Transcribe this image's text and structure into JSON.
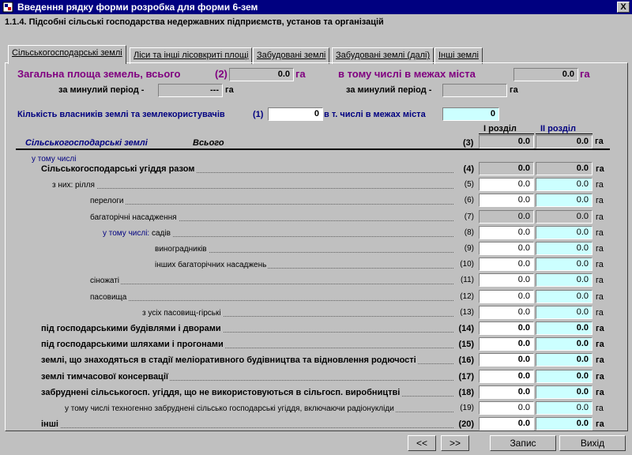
{
  "window": {
    "title": "Введення рядку форми розробка для форми 6-зем",
    "close_label": "X"
  },
  "subtitle": "1.1.4. Підсобні сільські господарства недержавних  підприємств, установ  та організацій",
  "tabs": [
    {
      "label": "Сільськогосподарські землі",
      "active": true
    },
    {
      "label": "Ліси та інші лісовкриті площі"
    },
    {
      "label": "Забудовані землі"
    },
    {
      "label": "Забудовані землі (далі)"
    },
    {
      "label": "Інші землі"
    }
  ],
  "header": {
    "total_area_label": "Загальна площа земель, всього",
    "total_area_code": "(2)",
    "total_area_value": "0.0",
    "city_label": "в тому числі в межах міста",
    "city_value": "0.0",
    "unit": "га",
    "prev_period_label": "за минулий період -",
    "prev_period_value": "---",
    "prev_period_city_label": "за минулий період -",
    "prev_period_city_value": "",
    "owners_label": "Кількість власників землі та землекористувачів",
    "owners_code": "(1)",
    "owners_value": "0",
    "owners_city_label": "в т. числі в межах міста",
    "owners_city_value": "0"
  },
  "table": {
    "section_label": "Сільськогосподарські землі",
    "total_label": "Всього",
    "total_code": "(3)",
    "col1_header": "І розділ",
    "col2_header": "ІІ розділ",
    "total_v1": "0.0",
    "total_v2": "0.0",
    "unit": "га",
    "including_note": "у тому числі",
    "rows": [
      {
        "label": "Сільськогосподарські угіддя разом",
        "code": "(4)",
        "v1": "0.0",
        "v2": "0.0",
        "bold": true,
        "style": "gray",
        "indent": 52
      },
      {
        "prefix": "з них: ",
        "label": "рілля",
        "code": "(5)",
        "v1": "0.0",
        "v2": "0.0",
        "style": "white",
        "indent": 66
      },
      {
        "label": "перелоги",
        "code": "(6)",
        "v1": "0.0",
        "v2": "0.0",
        "style": "white",
        "indent": 114
      },
      {
        "label": "багаторічні насадження",
        "code": "(7)",
        "v1": "0.0",
        "v2": "0.0",
        "style": "gray",
        "indent": 114
      },
      {
        "prefix_blue": "у тому числі: ",
        "label": "садів",
        "code": "(8)",
        "v1": "0.0",
        "v2": "0.0",
        "style": "white",
        "indent": 130
      },
      {
        "label": "виноградників",
        "code": "(9)",
        "v1": "0.0",
        "v2": "0.0",
        "style": "white",
        "indent": 196
      },
      {
        "label": "інших багаторічних насаджень",
        "code": "(10)",
        "v1": "0.0",
        "v2": "0.0",
        "style": "white",
        "indent": 196
      },
      {
        "label": "сіножаті",
        "code": "(11)",
        "v1": "0.0",
        "v2": "0.0",
        "style": "white",
        "indent": 114
      },
      {
        "label": "пасовища",
        "code": "(12)",
        "v1": "0.0",
        "v2": "0.0",
        "style": "white",
        "indent": 114
      },
      {
        "label": "з усіх пасовищ-гірські",
        "code": "(13)",
        "v1": "0.0",
        "v2": "0.0",
        "style": "white",
        "indent": 180
      },
      {
        "label": "під господарськими будівлями і дворами",
        "code": "(14)",
        "v1": "0.0",
        "v2": "0.0",
        "bold": true,
        "style": "white",
        "indent": 52
      },
      {
        "label": "під господарськими шляхами і прогонами",
        "code": "(15)",
        "v1": "0.0",
        "v2": "0.0",
        "bold": true,
        "style": "white",
        "indent": 52
      },
      {
        "label": "землі, що знаходяться в стадії меліоративного будівництва та відновлення родючості",
        "code": "(16)",
        "v1": "0.0",
        "v2": "0.0",
        "bold": true,
        "style": "white",
        "indent": 52
      },
      {
        "label": "землі тимчасової консервації",
        "code": "(17)",
        "v1": "0.0",
        "v2": "0.0",
        "bold": true,
        "style": "white",
        "indent": 52
      },
      {
        "label": "забруднені сільськогосп. угіддя, що не використовуються в сільгосп. виробництві",
        "code": "(18)",
        "v1": "0.0",
        "v2": "0.0",
        "bold": true,
        "style": "white",
        "indent": 52
      },
      {
        "label": "у тому числі техногенно забруднені сільсько господарські угіддя, включаючи радіонукліди",
        "code": "(19)",
        "v1": "0.0",
        "v2": "0.0",
        "style": "white",
        "indent": 82,
        "small": true
      },
      {
        "label": "інші",
        "code": "(20)",
        "v1": "0.0",
        "v2": "0.0",
        "bold": true,
        "style": "white",
        "indent": 52
      }
    ]
  },
  "buttons": {
    "prev": "<<",
    "next": ">>",
    "save": "Запис",
    "exit": "Вихід"
  },
  "colors": {
    "titlebar": "#000080",
    "purple": "#800080",
    "cyan": "#ccffff",
    "navy": "#000080"
  }
}
